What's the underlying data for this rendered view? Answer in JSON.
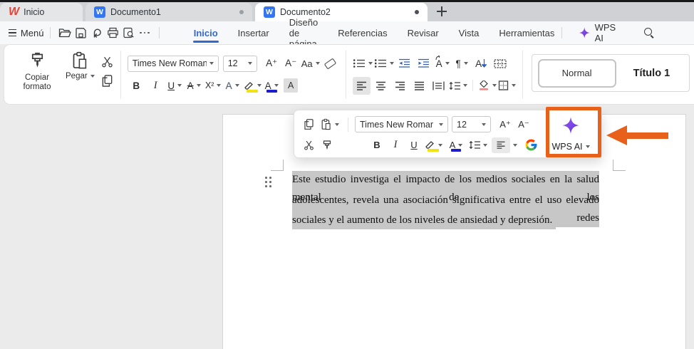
{
  "tabbar": {
    "home_tab": "Inicio",
    "tabs": [
      {
        "label": "Documento1"
      },
      {
        "label": "Documento2"
      }
    ]
  },
  "menubar": {
    "menu": "Menú",
    "tabs": [
      "Inicio",
      "Insertar",
      "Diseño de página",
      "Referencias",
      "Revisar",
      "Vista",
      "Herramientas"
    ],
    "wps_ai": "WPS AI"
  },
  "ribbon": {
    "copy_format": "Copiar formato",
    "paste": "Pegar",
    "font_family": "Times New Roman",
    "font_size": "12",
    "styles": [
      {
        "label": "Normal"
      },
      {
        "label": "Título 1"
      }
    ]
  },
  "glyphs": {
    "bold": "B",
    "italic": "I",
    "underline": "U",
    "strike": "A",
    "superscript": "X²",
    "grow": "A⁺",
    "shrink": "A⁻",
    "case": "Aa",
    "effects": "A",
    "shade_char": "A",
    "font_color": "A",
    "sort": "A",
    "direction": "A",
    "pilcrow": "¶"
  },
  "popup": {
    "font_family": "Times New Romar",
    "font_size": "12",
    "wps_ai": "WPS AI"
  },
  "doc": {
    "lines": [
      "Este estudio investiga el impacto de los medios sociales en la salud mental de los",
      "adolescentes, revela una asociación significativa entre el uso elevado de las redes",
      "sociales y el aumento de los niveles de ansiedad y depresión."
    ]
  },
  "colors": {
    "accent_blue": "#3468d1",
    "annotation_orange": "#e8611a",
    "selection_gray": "#c7c7c7",
    "highlight_swatch": "#f0e213",
    "font_color_swatch": "#1c1ccd",
    "wps_logo_red": "#e34335",
    "doc_icon_blue": "#3575f0",
    "ai_purple_start": "#9d5cf5",
    "ai_purple_end": "#5b2fd4"
  }
}
